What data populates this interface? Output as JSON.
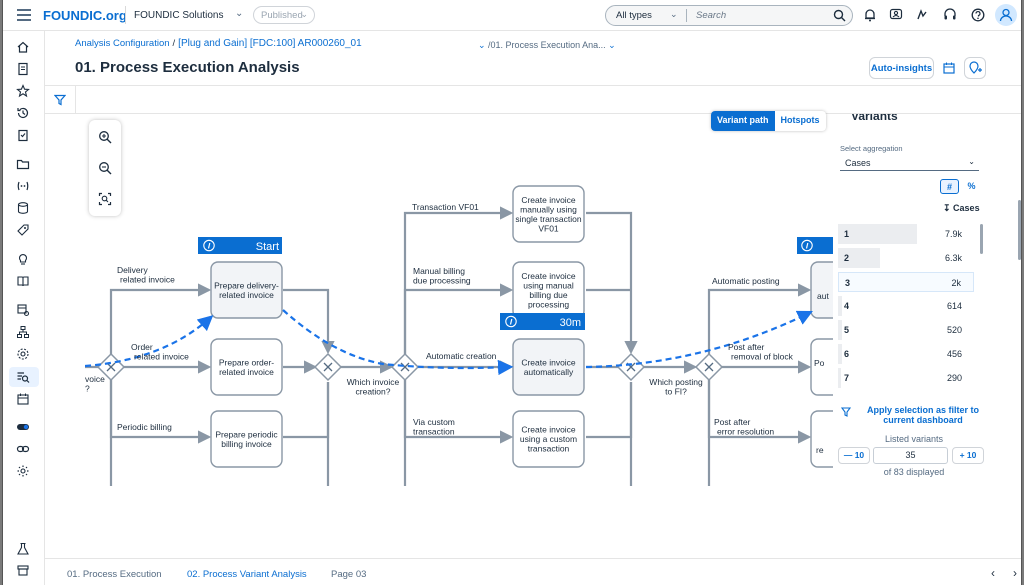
{
  "shell": {
    "brand": "FOUNDIC.org",
    "workspace": "FOUNDIC Solutions",
    "status": "Published",
    "search_type": "All types",
    "search_placeholder": "Search"
  },
  "header": {
    "breadcrumb_root": "Analysis Configuration",
    "breadcrumb_item": "[Plug and Gain] [FDC:100] AR000260_01",
    "breadcrumb_page": "/01. Process Execution Ana...",
    "title": "01. Process Execution Analysis",
    "auto_insights": "Auto-insights"
  },
  "canvas": {
    "tab_variant_path": "Variant path",
    "tab_hotspots": "Hotspots",
    "start_label": "Start",
    "duration_label": "30m",
    "nodes": [
      {
        "key": "n1",
        "lines": [
          "Prepare delivery-",
          "related invoice"
        ]
      },
      {
        "key": "n2",
        "lines": [
          "Prepare order-",
          "related invoice"
        ]
      },
      {
        "key": "n3",
        "lines": [
          "Prepare periodic",
          "billing invoice"
        ]
      },
      {
        "key": "n4",
        "lines": [
          "Create invoice",
          "manually using",
          "single transaction",
          "VF01"
        ]
      },
      {
        "key": "n5",
        "lines": [
          "Create invoice",
          "using manual",
          "billing due",
          "processing"
        ]
      },
      {
        "key": "n6",
        "lines": [
          "Create invoice",
          "automatically"
        ]
      },
      {
        "key": "n7",
        "lines": [
          "Create invoice",
          "using a custom",
          "transaction"
        ]
      },
      {
        "key": "n8",
        "lines": [
          "aut"
        ]
      },
      {
        "key": "n9",
        "lines": [
          "Po"
        ]
      },
      {
        "key": "n10",
        "lines": [
          "re"
        ]
      }
    ],
    "edge_labels": {
      "delivery": [
        "Delivery",
        "related invoice"
      ],
      "order": [
        "Order",
        "related invoice"
      ],
      "periodic": [
        "Periodic billing"
      ],
      "which_invoice": [
        "Which invoice",
        "creation?"
      ],
      "left_cut": [
        "voice",
        "?"
      ],
      "vf01": [
        "Transaction VF01"
      ],
      "manual_billing": [
        "Manual billing",
        "due processing"
      ],
      "auto_creation": [
        "Automatic creation"
      ],
      "custom": [
        "Via custom",
        "transaction"
      ],
      "which_posting": [
        "Which posting",
        "to FI?"
      ],
      "auto_posting": [
        "Automatic posting"
      ],
      "post_after_block": [
        "Post after",
        "removal of block"
      ],
      "post_after_error": [
        "Post after",
        "error resolution"
      ]
    }
  },
  "variants": {
    "title": "Variants",
    "aggregation_label": "Select aggregation",
    "aggregation_value": "Cases",
    "toggle_count": "#",
    "toggle_percent": "%",
    "cases_header": "Cases",
    "rows": [
      {
        "rank": "1",
        "cases": "7.9k",
        "share": 0.58
      },
      {
        "rank": "2",
        "cases": "6.3k",
        "share": 0.31
      },
      {
        "rank": "3",
        "cases": "2k",
        "share": 0.0
      },
      {
        "rank": "4",
        "cases": "614",
        "share": 0.03
      },
      {
        "rank": "5",
        "cases": "520",
        "share": 0.03
      },
      {
        "rank": "6",
        "cases": "456",
        "share": 0.03
      },
      {
        "rank": "7",
        "cases": "290",
        "share": 0.02
      }
    ],
    "apply_filter": "Apply selection as filter to current dashboard",
    "listed_label": "Listed variants",
    "minus_label": "— 10",
    "plus_label": "+ 10",
    "listed_value": "35",
    "displayed": "of 83 displayed"
  },
  "bottom_tabs": [
    {
      "label": "01. Process Execution"
    },
    {
      "label": "02. Process Variant Analysis"
    },
    {
      "label": "Page 03"
    }
  ],
  "colors": {
    "accent": "#0a6ed1",
    "path": "#1a73e8",
    "edge": "#8a97a5"
  }
}
